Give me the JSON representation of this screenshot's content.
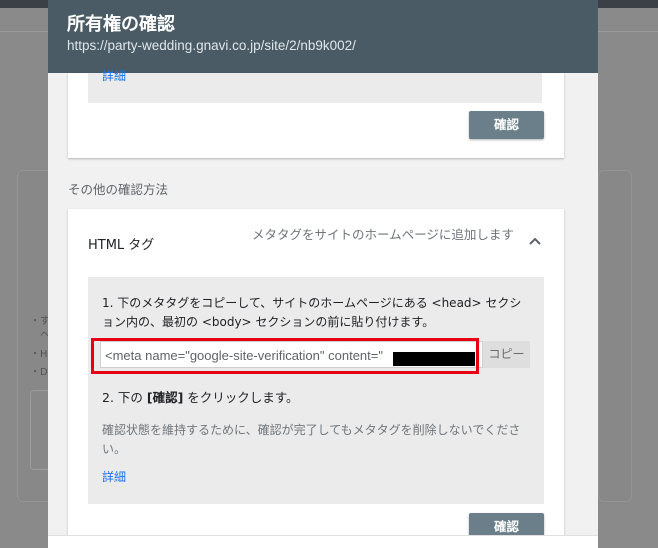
{
  "dialog": {
    "title": "所有権の確認",
    "url": "https://party-wedding.gnavi.co.jp/site/2/nb9k002/"
  },
  "top_card": {
    "detail_link": "詳細",
    "confirm_button": "確認"
  },
  "other_methods_label": "その他の確認方法",
  "html_tag_method": {
    "title": "HTML タグ",
    "description": "メタタグをサイトのホームページに追加します",
    "step1": "1. 下のメタタグをコピーして、サイトのホームページにある <head> セクション内の、最初の <body> セクションの前に貼り付けます。",
    "meta_value": "<meta name=\"google-site-verification\" content=\"",
    "copy_button": "コピー",
    "step2_prefix": "2. 下の ",
    "step2_bold": "[確認]",
    "step2_suffix": " をクリックします。",
    "note": "確認状態を維持するために、確認が完了してもメタタグを削除しないでください。",
    "detail_link": "詳細",
    "confirm_button": "確認"
  },
  "background": {
    "bullets": [
      "・す",
      "ヘ",
      "・H",
      "・D"
    ]
  },
  "colors": {
    "header": "#4a5b66",
    "confirm_button": "#6a7f89",
    "link": "#1a73e8",
    "highlight": "#e60012"
  }
}
